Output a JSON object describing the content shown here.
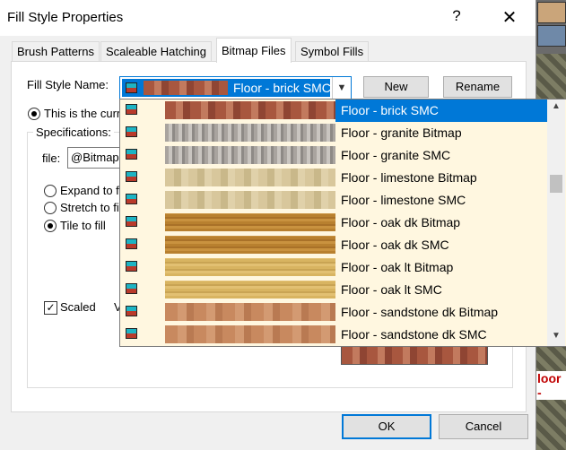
{
  "window": {
    "title": "Fill Style Properties",
    "help_glyph": "?",
    "close_glyph": "✕"
  },
  "tabs": [
    {
      "label": "Brush Patterns"
    },
    {
      "label": "Scaleable Hatching"
    },
    {
      "label": "Bitmap Files",
      "active": true
    },
    {
      "label": "Symbol Fills"
    }
  ],
  "form": {
    "fill_style_label": "Fill Style Name:",
    "fill_style_value": "Floor - brick SMC",
    "new_button": "New",
    "rename_button": "Rename",
    "current_radio_label": "This is the curr",
    "specifications_label": "Specifications:",
    "file_label": "file:",
    "file_value": "@Bitmap",
    "radio_expand": "Expand to f",
    "radio_stretch": "Stretch to fi",
    "radio_tile": "Tile to fill",
    "scaled_label": "Scaled",
    "scaled_checked": true,
    "scaled_suffix": "V"
  },
  "dropdown": {
    "items": [
      {
        "label": "Floor - brick SMC",
        "selected": true,
        "swatch": "brick"
      },
      {
        "label": "Floor - granite Bitmap",
        "swatch": "granite"
      },
      {
        "label": "Floor - granite SMC",
        "swatch": "granite"
      },
      {
        "label": "Floor - limestone Bitmap",
        "swatch": "lime"
      },
      {
        "label": "Floor - limestone SMC",
        "swatch": "lime"
      },
      {
        "label": "Floor - oak dk Bitmap",
        "swatch": "oakdk"
      },
      {
        "label": "Floor - oak dk SMC",
        "swatch": "oakdk"
      },
      {
        "label": "Floor - oak lt Bitmap",
        "swatch": "oaklt"
      },
      {
        "label": "Floor - oak lt SMC",
        "swatch": "oaklt"
      },
      {
        "label": "Floor - sandstone dk Bitmap",
        "swatch": "sand"
      },
      {
        "label": "Floor - sandstone dk SMC",
        "swatch": "sand"
      }
    ]
  },
  "footer": {
    "ok_button": "OK",
    "cancel_button": "Cancel"
  },
  "background_app": {
    "partial_text": "loor -"
  },
  "colors": {
    "accent": "#0078d7",
    "dropdown_bg": "#fff7e0"
  }
}
